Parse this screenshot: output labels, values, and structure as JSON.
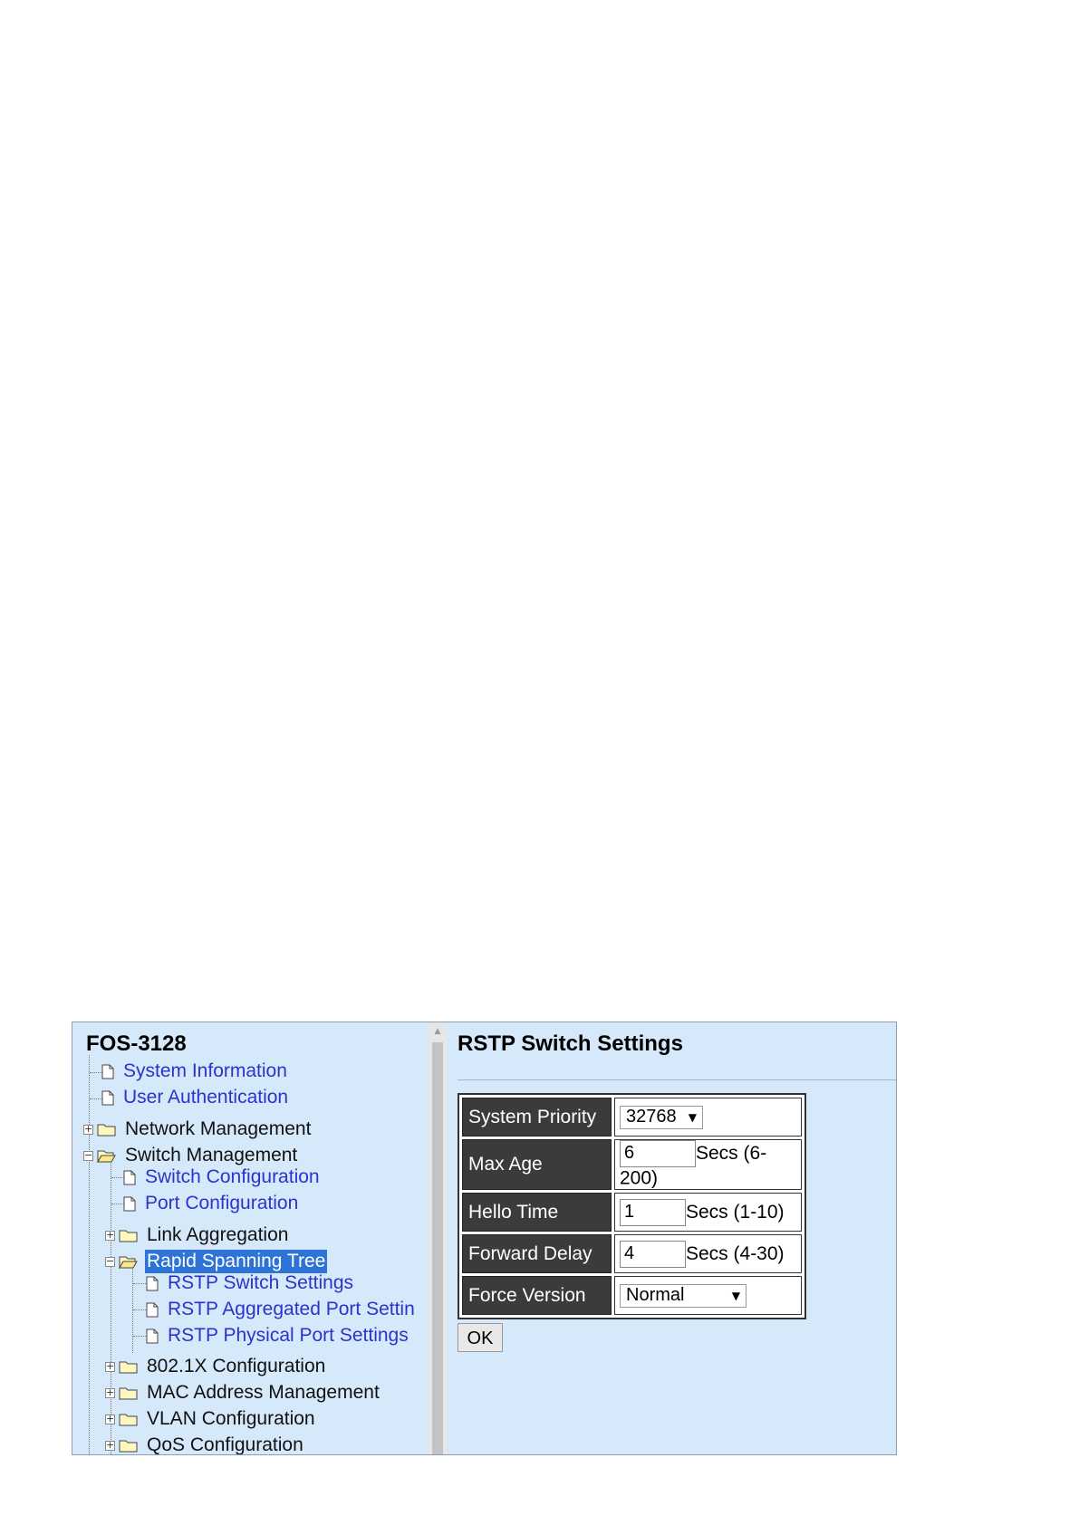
{
  "tree": {
    "title": "FOS-3128",
    "items": {
      "system_information": "System Information",
      "user_authentication": "User Authentication",
      "network_management": "Network Management",
      "switch_management": "Switch Management",
      "switch_configuration": "Switch Configuration",
      "port_configuration": "Port Configuration",
      "link_aggregation": "Link Aggregation",
      "rapid_spanning_tree": "Rapid Spanning Tree",
      "rstp_switch_settings": "RSTP Switch Settings",
      "rstp_aggregated_port_settings": "RSTP Aggregated Port Settin",
      "rstp_physical_port_settings": "RSTP Physical Port Settings",
      "dot1x_configuration": "802.1X Configuration",
      "mac_address_management": "MAC Address Management",
      "vlan_configuration": "VLAN Configuration",
      "qos_configuration": "QoS Configuration"
    }
  },
  "main": {
    "title": "RSTP Switch Settings",
    "fields": {
      "system_priority": {
        "label": "System Priority",
        "value": "32768"
      },
      "max_age": {
        "label": "Max Age",
        "value": "6",
        "unit": "Secs (6-200)"
      },
      "hello_time": {
        "label": "Hello Time",
        "value": "1",
        "unit": "Secs (1-10)"
      },
      "forward_delay": {
        "label": "Forward Delay",
        "value": "4",
        "unit": "Secs (4-30)"
      },
      "force_version": {
        "label": "Force Version",
        "value": "Normal"
      }
    },
    "ok_label": "OK"
  },
  "colors": {
    "panel_bg": "#d6e9fb",
    "link": "#2a33cc",
    "selection": "#2e73d6",
    "label_cell": "#3b3b3b"
  },
  "icons": {
    "page": "document-icon",
    "folder": "folder-icon",
    "open_folder": "open-folder-icon",
    "expand": "plus-box-icon",
    "collapse": "minus-box-icon"
  }
}
